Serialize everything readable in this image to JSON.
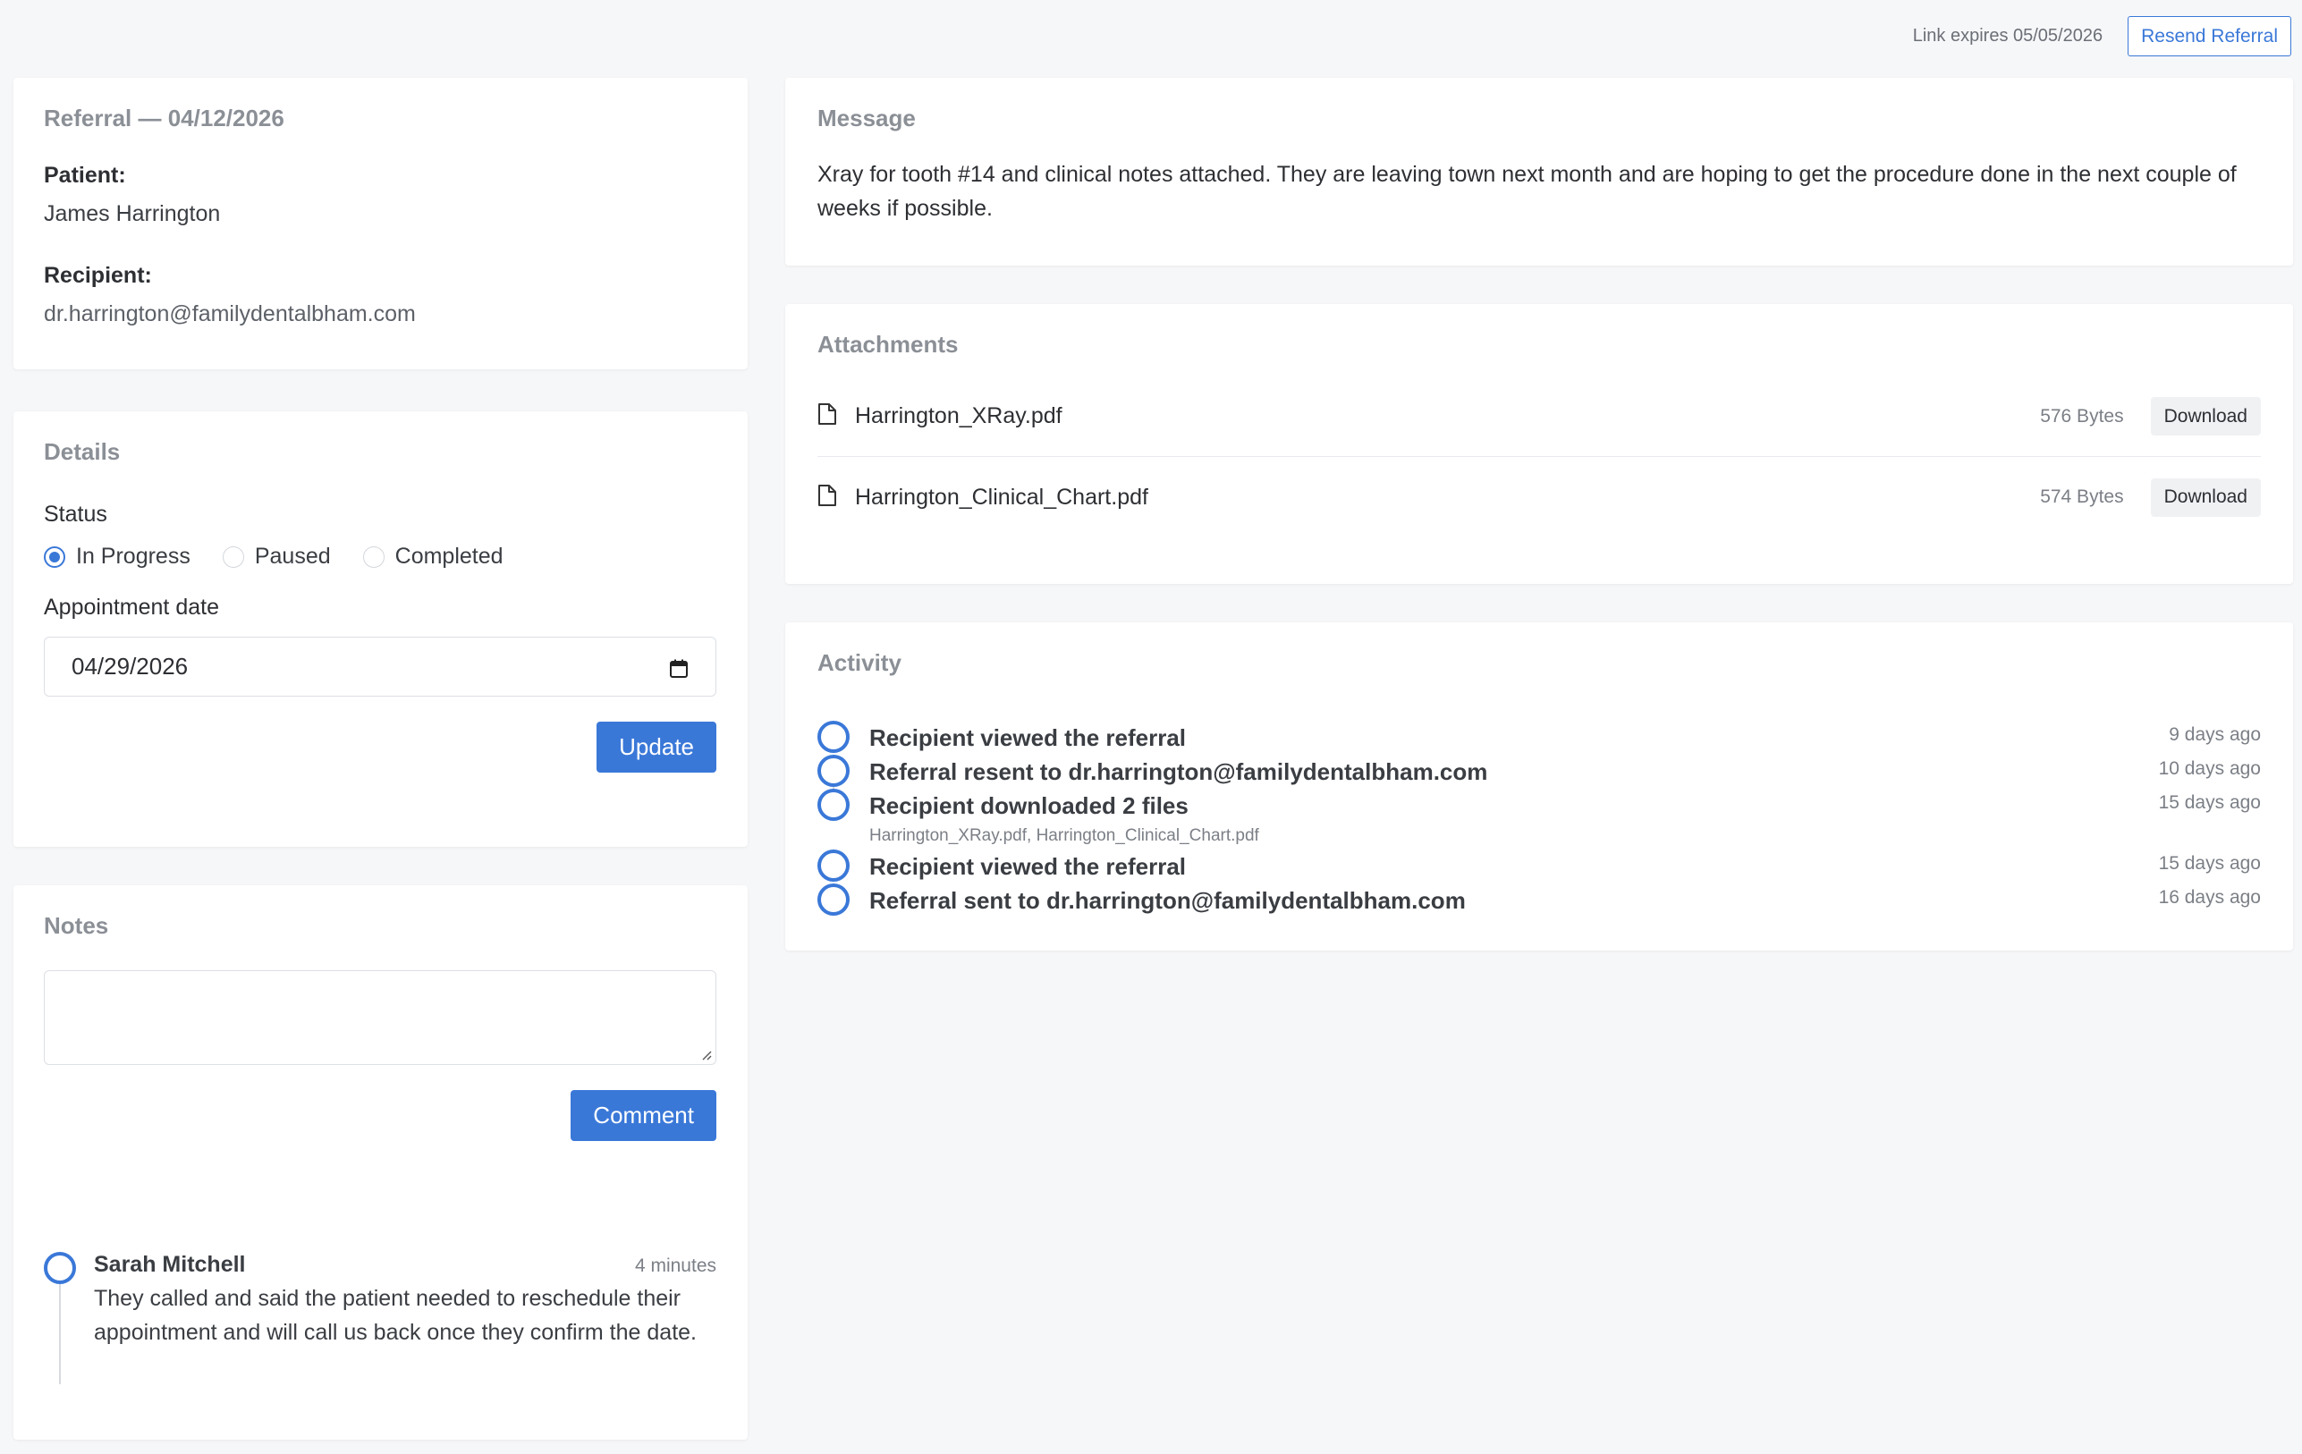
{
  "header": {
    "link_expires": "Link expires 05/05/2026",
    "resend_label": "Resend Referral"
  },
  "referral": {
    "title": "Referral — 04/12/2026",
    "patient_label": "Patient:",
    "patient_name": "James Harrington",
    "recipient_label": "Recipient:",
    "recipient_email": "dr.harrington@familydentalbham.com"
  },
  "details": {
    "title": "Details",
    "status_label": "Status",
    "status_options": [
      "In Progress",
      "Paused",
      "Completed"
    ],
    "status_selected": "In Progress",
    "appointment_label": "Appointment date",
    "appointment_value": "04/29/2026",
    "update_label": "Update"
  },
  "notes": {
    "title": "Notes",
    "comment_placeholder": "",
    "comment_button": "Comment",
    "entries": [
      {
        "author": "Sarah Mitchell",
        "time": "4 minutes",
        "text": "They called and said the patient needed to reschedule their appointment and will call us back once they confirm the date."
      }
    ]
  },
  "message": {
    "title": "Message",
    "body": "Xray for tooth #14 and clinical notes attached. They are leaving town next month and are hoping to get the procedure done in the next couple of weeks if possible."
  },
  "attachments": {
    "title": "Attachments",
    "download_label": "Download",
    "files": [
      {
        "name": "Harrington_XRay.pdf",
        "size": "576 Bytes"
      },
      {
        "name": "Harrington_Clinical_Chart.pdf",
        "size": "574 Bytes"
      }
    ]
  },
  "activity": {
    "title": "Activity",
    "items": [
      {
        "text": "Recipient viewed the referral",
        "time": "9 days ago",
        "sub": ""
      },
      {
        "text": "Referral resent to dr.harrington@familydentalbham.com",
        "time": "10 days ago",
        "sub": ""
      },
      {
        "text": "Recipient downloaded 2 files",
        "time": "15 days ago",
        "sub": "Harrington_XRay.pdf, Harrington_Clinical_Chart.pdf"
      },
      {
        "text": "Recipient viewed the referral",
        "time": "15 days ago",
        "sub": ""
      },
      {
        "text": "Referral sent to dr.harrington@familydentalbham.com",
        "time": "16 days ago",
        "sub": ""
      }
    ]
  },
  "colors": {
    "accent": "#3a78d8",
    "background": "#f6f7f9"
  }
}
